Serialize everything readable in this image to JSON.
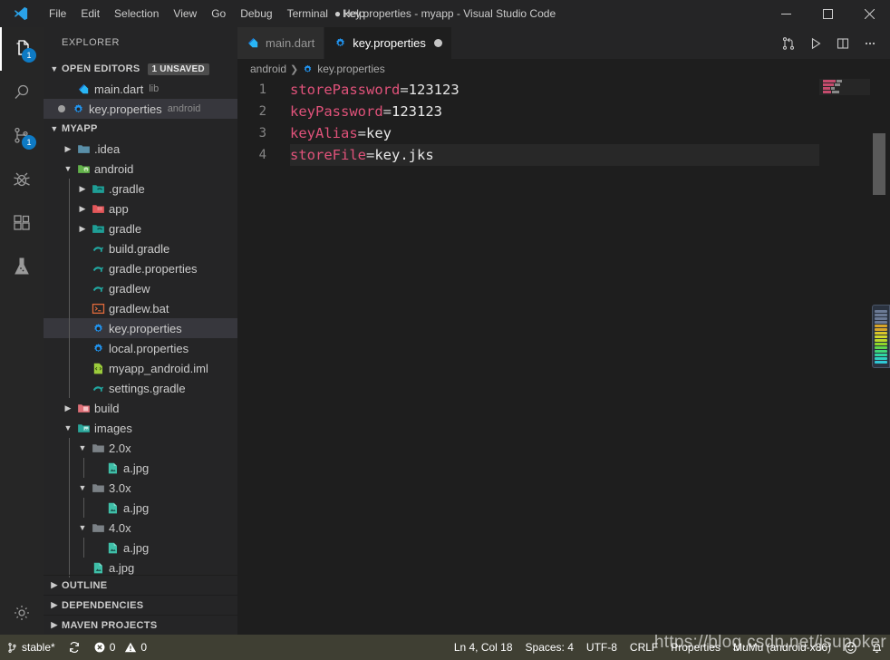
{
  "window": {
    "title": "● key.properties - myapp - Visual Studio Code",
    "minimize_label": "Minimize",
    "maximize_label": "Maximize",
    "close_label": "Close"
  },
  "menu": {
    "items": [
      {
        "label": "File"
      },
      {
        "label": "Edit"
      },
      {
        "label": "Selection"
      },
      {
        "label": "View"
      },
      {
        "label": "Go"
      },
      {
        "label": "Debug"
      },
      {
        "label": "Terminal"
      },
      {
        "label": "Help"
      }
    ]
  },
  "activity_bar": {
    "items": [
      {
        "name": "explorer",
        "icon": "files-icon",
        "badge": "1",
        "active": true
      },
      {
        "name": "search",
        "icon": "search-icon",
        "badge": "",
        "active": false
      },
      {
        "name": "source-control",
        "icon": "source-control-icon",
        "badge": "1",
        "active": false
      },
      {
        "name": "debug",
        "icon": "debug-icon",
        "badge": "",
        "active": false
      },
      {
        "name": "extensions",
        "icon": "extensions-icon",
        "badge": "",
        "active": false
      },
      {
        "name": "testing",
        "icon": "beaker-icon",
        "badge": "",
        "active": false
      }
    ],
    "bottom": [
      {
        "name": "manage",
        "icon": "gear-icon"
      }
    ]
  },
  "sidebar": {
    "title": "EXPLORER",
    "open_editors": {
      "label": "OPEN EDITORS",
      "badge": "1 UNSAVED",
      "items": [
        {
          "name": "main.dart",
          "desc": "lib",
          "icon": "dart-icon",
          "dirty": false,
          "selected": false
        },
        {
          "name": "key.properties",
          "desc": "android",
          "icon": "properties-icon",
          "dirty": true,
          "selected": true
        }
      ]
    },
    "project": {
      "label": "MYAPP",
      "tree": [
        {
          "name": ".idea",
          "type": "folder",
          "icon": "folder-blue-icon",
          "depth": 1,
          "expanded": false,
          "selected": false
        },
        {
          "name": "android",
          "type": "folder",
          "icon": "folder-android-icon",
          "depth": 1,
          "expanded": true,
          "selected": false
        },
        {
          "name": ".gradle",
          "type": "folder",
          "icon": "folder-gradle-icon",
          "depth": 2,
          "expanded": false,
          "selected": false
        },
        {
          "name": "app",
          "type": "folder",
          "icon": "folder-app-icon",
          "depth": 2,
          "expanded": false,
          "selected": false
        },
        {
          "name": "gradle",
          "type": "folder",
          "icon": "folder-gradle-icon",
          "depth": 2,
          "expanded": false,
          "selected": false
        },
        {
          "name": "build.gradle",
          "type": "file",
          "icon": "gradle-icon",
          "depth": 2,
          "expanded": null,
          "selected": false
        },
        {
          "name": "gradle.properties",
          "type": "file",
          "icon": "gradle-icon",
          "depth": 2,
          "expanded": null,
          "selected": false
        },
        {
          "name": "gradlew",
          "type": "file",
          "icon": "gradle-icon",
          "depth": 2,
          "expanded": null,
          "selected": false
        },
        {
          "name": "gradlew.bat",
          "type": "file",
          "icon": "console-icon",
          "depth": 2,
          "expanded": null,
          "selected": false
        },
        {
          "name": "key.properties",
          "type": "file",
          "icon": "properties-icon",
          "depth": 2,
          "expanded": null,
          "selected": true
        },
        {
          "name": "local.properties",
          "type": "file",
          "icon": "properties-icon",
          "depth": 2,
          "expanded": null,
          "selected": false
        },
        {
          "name": "myapp_android.iml",
          "type": "file",
          "icon": "iml-icon",
          "depth": 2,
          "expanded": null,
          "selected": false
        },
        {
          "name": "settings.gradle",
          "type": "file",
          "icon": "gradle-icon",
          "depth": 2,
          "expanded": null,
          "selected": false
        },
        {
          "name": "build",
          "type": "folder",
          "icon": "folder-build-icon",
          "depth": 1,
          "expanded": false,
          "selected": false
        },
        {
          "name": "images",
          "type": "folder",
          "icon": "folder-images-icon",
          "depth": 1,
          "expanded": true,
          "selected": false
        },
        {
          "name": "2.0x",
          "type": "folder",
          "icon": "folder-gray-icon",
          "depth": 2,
          "expanded": true,
          "selected": false
        },
        {
          "name": "a.jpg",
          "type": "file",
          "icon": "image-icon",
          "depth": 3,
          "expanded": null,
          "selected": false
        },
        {
          "name": "3.0x",
          "type": "folder",
          "icon": "folder-gray-icon",
          "depth": 2,
          "expanded": true,
          "selected": false
        },
        {
          "name": "a.jpg",
          "type": "file",
          "icon": "image-icon",
          "depth": 3,
          "expanded": null,
          "selected": false
        },
        {
          "name": "4.0x",
          "type": "folder",
          "icon": "folder-gray-icon",
          "depth": 2,
          "expanded": true,
          "selected": false
        },
        {
          "name": "a.jpg",
          "type": "file",
          "icon": "image-icon",
          "depth": 3,
          "expanded": null,
          "selected": false
        },
        {
          "name": "a.jpg",
          "type": "file",
          "icon": "image-icon",
          "depth": 2,
          "expanded": null,
          "selected": false
        }
      ]
    },
    "bottom_sections": [
      {
        "label": "OUTLINE"
      },
      {
        "label": "DEPENDENCIES"
      },
      {
        "label": "MAVEN PROJECTS"
      }
    ]
  },
  "editor": {
    "tabs": [
      {
        "label": "main.dart",
        "icon": "dart-icon",
        "active": false,
        "dirty": false
      },
      {
        "label": "key.properties",
        "icon": "properties-icon",
        "active": true,
        "dirty": true
      }
    ],
    "actions": [
      {
        "name": "open-changes",
        "icon": "compare-icon"
      },
      {
        "name": "run-file",
        "icon": "play-icon"
      },
      {
        "name": "split-editor",
        "icon": "split-icon"
      },
      {
        "name": "more-actions",
        "icon": "ellipsis-icon"
      }
    ],
    "breadcrumb": [
      {
        "label": "android",
        "icon": ""
      },
      {
        "label": "key.properties",
        "icon": "properties-icon"
      }
    ],
    "lines": [
      {
        "num": "1",
        "key": "storePassword",
        "eq": "=",
        "value": "123123",
        "active": false
      },
      {
        "num": "2",
        "key": "keyPassword",
        "eq": "=",
        "value": "123123",
        "active": false
      },
      {
        "num": "3",
        "key": "keyAlias",
        "eq": "=",
        "value": "key",
        "active": false
      },
      {
        "num": "4",
        "key": "storeFile",
        "eq": "=",
        "value": "key.jks",
        "active": true
      }
    ]
  },
  "status_bar": {
    "left": [
      {
        "name": "branch",
        "icon": "git-branch-icon",
        "label": "stable*"
      },
      {
        "name": "sync",
        "icon": "sync-icon",
        "label": ""
      },
      {
        "name": "errors",
        "icon": "error-icon",
        "label": "0"
      },
      {
        "name": "warnings",
        "icon": "warning-icon",
        "label": "0"
      }
    ],
    "right": [
      {
        "name": "cursor-position",
        "label": "Ln 4, Col 18"
      },
      {
        "name": "indentation",
        "label": "Spaces: 4"
      },
      {
        "name": "encoding",
        "label": "UTF-8"
      },
      {
        "name": "eol",
        "label": "CRLF"
      },
      {
        "name": "language-mode",
        "label": "Properties"
      },
      {
        "name": "device-selector",
        "label": "MuMu (android-x86)"
      },
      {
        "name": "feedback",
        "icon": "smiley-icon",
        "label": ""
      },
      {
        "name": "notifications",
        "icon": "bell-icon",
        "label": ""
      }
    ]
  },
  "watermark": {
    "text": "https://blog.csdn.net/jsupoker"
  },
  "colors": {
    "accent": "#0e7ac4",
    "key": "#e0527a",
    "value": "#e8e8e8",
    "status_bar": "#3f3f33",
    "sidebar_bg": "#252526",
    "editor_bg": "#1e1e1e"
  }
}
